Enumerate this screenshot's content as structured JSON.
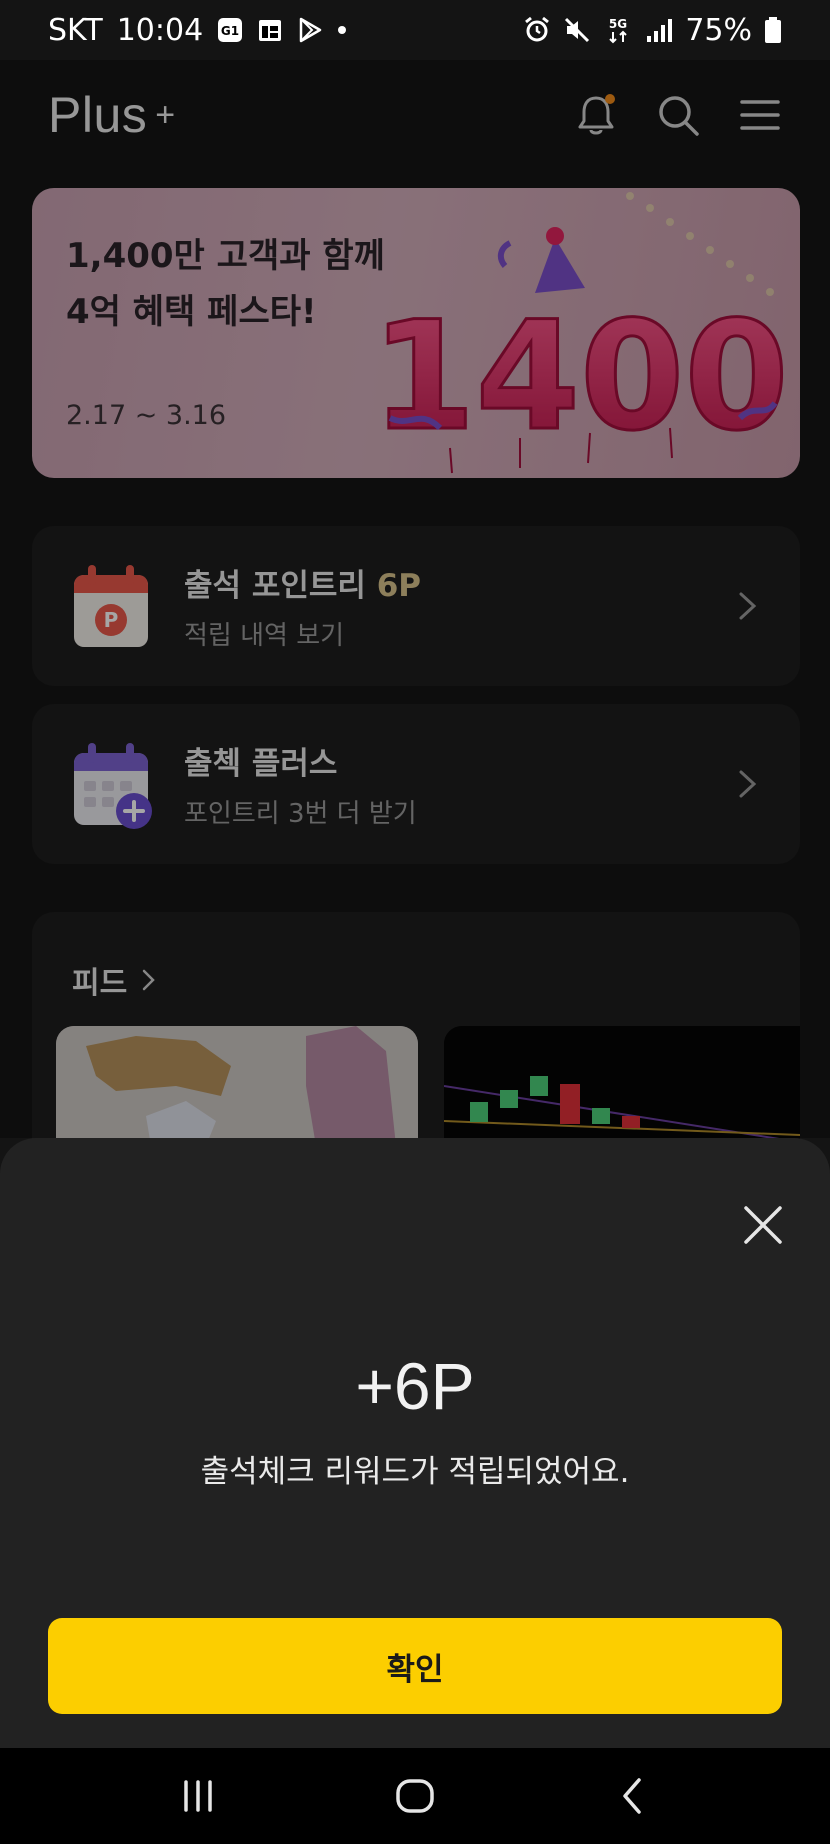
{
  "status_bar": {
    "carrier": "SKT",
    "time": "10:04",
    "battery": "75%",
    "left_icons": [
      "g1-app-icon",
      "calendar-app-icon",
      "play-store-icon",
      "dot-icon"
    ],
    "right_icons": [
      "alarm-icon",
      "mute-icon",
      "5g-data-icon",
      "signal-icon",
      "battery-icon"
    ]
  },
  "header": {
    "logo_text": "Plus",
    "logo_mark": "+",
    "icons": [
      "bell-icon",
      "search-icon",
      "menu-icon"
    ],
    "notification_dot_color": "#f28a1a"
  },
  "banner": {
    "title_line1": "1,400만 고객과 함께",
    "title_line2": "4억 혜택 페스타!",
    "date": "2.17 ~ 3.16",
    "art_text": "1400",
    "accent_color": "#e0245e"
  },
  "attendance_card": {
    "title": "출석 포인트리",
    "points": "6P",
    "subtitle": "적립 내역 보기",
    "icon_letter": "P"
  },
  "check_plus_card": {
    "title": "출첵 플러스",
    "subtitle": "포인트리 3번 더 받기"
  },
  "feed": {
    "title": "피드"
  },
  "sheet": {
    "points": "+6P",
    "message": "출석체크 리워드가 적립되었어요.",
    "confirm_label": "확인",
    "button_color": "#fcce00"
  },
  "nav_bar": {
    "buttons": [
      "recent-apps-icon",
      "home-icon",
      "back-icon"
    ]
  }
}
